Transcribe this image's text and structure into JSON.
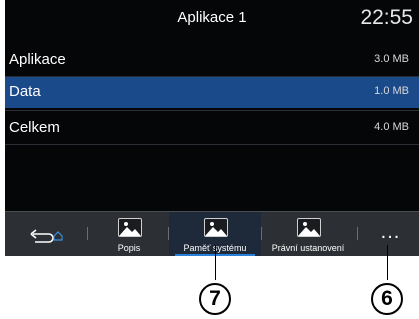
{
  "header": {
    "title": "Aplikace 1",
    "clock": "22:55"
  },
  "rows": [
    {
      "label": "Aplikace",
      "size": "3.0 MB",
      "selected": false
    },
    {
      "label": "Data",
      "size": "1.0 MB",
      "selected": true
    },
    {
      "label": "Celkem",
      "size": "4.0 MB",
      "selected": false
    }
  ],
  "tabs": {
    "back_icon": "back-home-icon",
    "items": [
      {
        "label": "Popis",
        "icon": "picture-icon",
        "active": false
      },
      {
        "label": "Paměť systému",
        "icon": "picture-icon",
        "active": true
      },
      {
        "label": "Právní ustanovení",
        "icon": "picture-icon",
        "active": false
      }
    ],
    "more_label": "...",
    "more_icon": "more-dots-icon"
  },
  "callouts": {
    "left": "7",
    "right": "6"
  },
  "colors": {
    "selected_row": "#1a4a8a",
    "active_underline": "#2a7fd6",
    "screen_bg": "#050608"
  }
}
